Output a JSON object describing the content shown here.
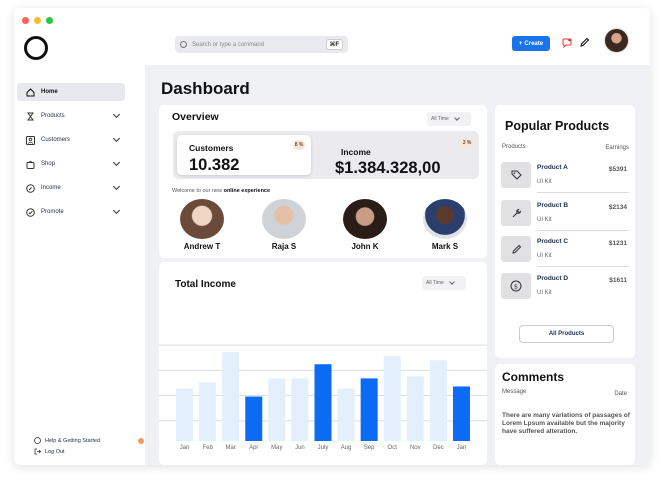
{
  "window": {
    "dots": [
      "#ff5f57",
      "#febc2e",
      "#28c840"
    ]
  },
  "search": {
    "placeholder": "Search or type a command",
    "shortcut": "⌘F"
  },
  "header": {
    "create_label": "Create",
    "create_plus": "+"
  },
  "sidebar": {
    "items": [
      {
        "label": "Home",
        "icon": "home-icon",
        "active": true
      },
      {
        "label": "Products",
        "icon": "hourglass-icon"
      },
      {
        "label": "Customers",
        "icon": "user-icon"
      },
      {
        "label": "Shop",
        "icon": "bag-icon"
      },
      {
        "label": "Income",
        "icon": "compass-icon"
      },
      {
        "label": "Promote",
        "icon": "check-circle-icon"
      }
    ],
    "help_label": "Help & Getting Started",
    "logout_label": "Log Out"
  },
  "page": {
    "title": "Dashboard"
  },
  "overview": {
    "title": "Overview",
    "range": "All Time",
    "customers": {
      "label": "Customers",
      "value": "10.382",
      "pct": "8 %"
    },
    "income": {
      "label": "Income",
      "value": "$1.384.328,00",
      "pct": "3 %"
    },
    "welcome_prefix": "Welcome to our new",
    "welcome_bold": "online experience",
    "people": [
      {
        "name": "Andrew T"
      },
      {
        "name": "Raja S"
      },
      {
        "name": "John K"
      },
      {
        "name": "Mark S"
      }
    ]
  },
  "total_income": {
    "title": "Total Income",
    "range": "All Time"
  },
  "chart_data": {
    "type": "bar",
    "categories": [
      "Jan",
      "Feb",
      "Mar",
      "Apr",
      "May",
      "Jun",
      "July",
      "Aug",
      "Sep",
      "Oct",
      "Nov",
      "Dec",
      "Jan"
    ],
    "values": [
      52,
      58,
      88,
      44,
      62,
      62,
      76,
      52,
      62,
      84,
      64,
      80,
      54
    ],
    "highlighted": [
      false,
      false,
      false,
      true,
      false,
      false,
      true,
      false,
      true,
      false,
      false,
      false,
      true
    ],
    "ylim": [
      0,
      100
    ],
    "grid": true,
    "colors": {
      "light": "#e3effd",
      "dark": "#0b6bf2",
      "grid": "#d8d8dc"
    }
  },
  "popular": {
    "title": "Popular Products",
    "col_products": "Products",
    "col_earnings": "Earnings",
    "items": [
      {
        "name": "Product A",
        "kit": "UI Kit",
        "earnings": "$5391",
        "icon": "tag-icon"
      },
      {
        "name": "Product B",
        "kit": "UI Kit",
        "earnings": "$2134",
        "icon": "wrench-icon"
      },
      {
        "name": "Product C",
        "kit": "UI Kit",
        "earnings": "$1231",
        "icon": "pencil-icon"
      },
      {
        "name": "Product D",
        "kit": "UI Kit",
        "earnings": "$1611",
        "icon": "dollar-icon"
      }
    ],
    "all_label": "All Products"
  },
  "comments": {
    "title": "Comments",
    "col_message": "Message",
    "col_date": "Date",
    "text": "There are many variations of passages of Lorem Lpsum available but the majority have suffered alteration."
  }
}
